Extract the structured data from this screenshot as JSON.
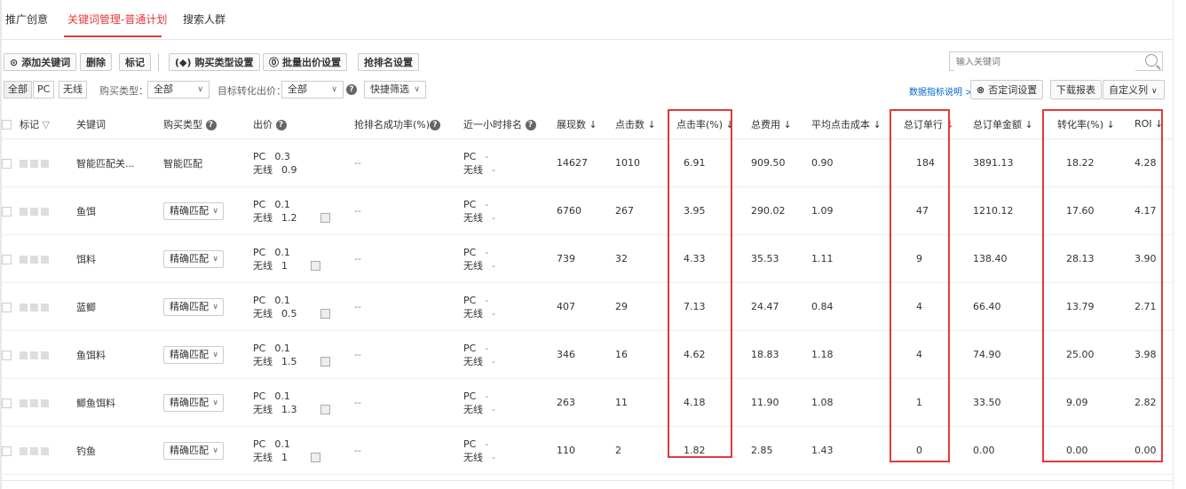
{
  "tabs": [
    "推广创意",
    "关键词管理-普通计划",
    "搜索人群"
  ],
  "toolbar": {
    "add_keyword": "添加关键词",
    "delete": "删除",
    "mark": "标记",
    "buy_type_setting": "购买类型设置",
    "batch_bid": "批量出价设置",
    "rank_setting": "抢排名设置",
    "search_placeholder": "输入关键词"
  },
  "filters": {
    "all": "全部",
    "pc": "PC",
    "wireless": "无线",
    "buy_type_label": "购买类型：",
    "buy_type_value": "全部",
    "target_bid_label": "目标转化出价：",
    "target_bid_value": "全部",
    "quick_filter": "快捷筛选",
    "metrics_help": "数据指标说明 >",
    "negative_words": "否定词设置",
    "download": "下载报表",
    "custom_cols": "自定义列"
  },
  "columns": {
    "mark": "标记",
    "keyword": "关键词",
    "buy_type": "购买类型",
    "bid": "出价",
    "rank_success": "抢排名成功率(%)",
    "recent_rank": "近一小时排名",
    "impressions": "展现数",
    "clicks": "点击数",
    "ctr": "点击率(%)",
    "total_cost": "总费用",
    "avg_cpc": "平均点击成本",
    "orders": "总订单行",
    "order_amount": "总订单金额",
    "conversion": "转化率(%)",
    "roi": "ROI"
  },
  "labels": {
    "pc": "PC",
    "wireless": "无线",
    "dash": "--",
    "dash_small": "-"
  },
  "rows": [
    {
      "keyword": "智能匹配关...",
      "buy_type": "智能匹配",
      "is_select": false,
      "bid_pc": "0.3",
      "bid_wireless": "0.9",
      "impressions": "14627",
      "clicks": "1010",
      "ctr": "6.91",
      "cost": "909.50",
      "cpc": "0.90",
      "orders": "184",
      "amount": "3891.13",
      "conversion": "18.22",
      "roi": "4.28"
    },
    {
      "keyword": "鱼饵",
      "buy_type": "精确匹配",
      "is_select": true,
      "bid_pc": "0.1",
      "bid_wireless": "1.2",
      "impressions": "6760",
      "clicks": "267",
      "ctr": "3.95",
      "cost": "290.02",
      "cpc": "1.09",
      "orders": "47",
      "amount": "1210.12",
      "conversion": "17.60",
      "roi": "4.17"
    },
    {
      "keyword": "饵料",
      "buy_type": "精确匹配",
      "is_select": true,
      "bid_pc": "0.1",
      "bid_wireless": "1",
      "impressions": "739",
      "clicks": "32",
      "ctr": "4.33",
      "cost": "35.53",
      "cpc": "1.11",
      "orders": "9",
      "amount": "138.40",
      "conversion": "28.13",
      "roi": "3.90"
    },
    {
      "keyword": "蓝鲫",
      "buy_type": "精确匹配",
      "is_select": true,
      "bid_pc": "0.1",
      "bid_wireless": "0.5",
      "impressions": "407",
      "clicks": "29",
      "ctr": "7.13",
      "cost": "24.47",
      "cpc": "0.84",
      "orders": "4",
      "amount": "66.40",
      "conversion": "13.79",
      "roi": "2.71"
    },
    {
      "keyword": "鱼饵料",
      "buy_type": "精确匹配",
      "is_select": true,
      "bid_pc": "0.1",
      "bid_wireless": "1.5",
      "impressions": "346",
      "clicks": "16",
      "ctr": "4.62",
      "cost": "18.83",
      "cpc": "1.18",
      "orders": "4",
      "amount": "74.90",
      "conversion": "25.00",
      "roi": "3.98"
    },
    {
      "keyword": "鲫鱼饵料",
      "buy_type": "精确匹配",
      "is_select": true,
      "bid_pc": "0.1",
      "bid_wireless": "1.3",
      "impressions": "263",
      "clicks": "11",
      "ctr": "4.18",
      "cost": "11.90",
      "cpc": "1.08",
      "orders": "1",
      "amount": "33.50",
      "conversion": "9.09",
      "roi": "2.82"
    },
    {
      "keyword": "钓鱼",
      "buy_type": "精确匹配",
      "is_select": true,
      "bid_pc": "0.1",
      "bid_wireless": "1",
      "impressions": "110",
      "clicks": "2",
      "ctr": "1.82",
      "cost": "2.85",
      "cpc": "1.43",
      "orders": "0",
      "amount": "0.00",
      "conversion": "0.00",
      "roi": "0.00"
    }
  ],
  "colors": {
    "accent": "#e4393c",
    "link": "#0066cc"
  }
}
